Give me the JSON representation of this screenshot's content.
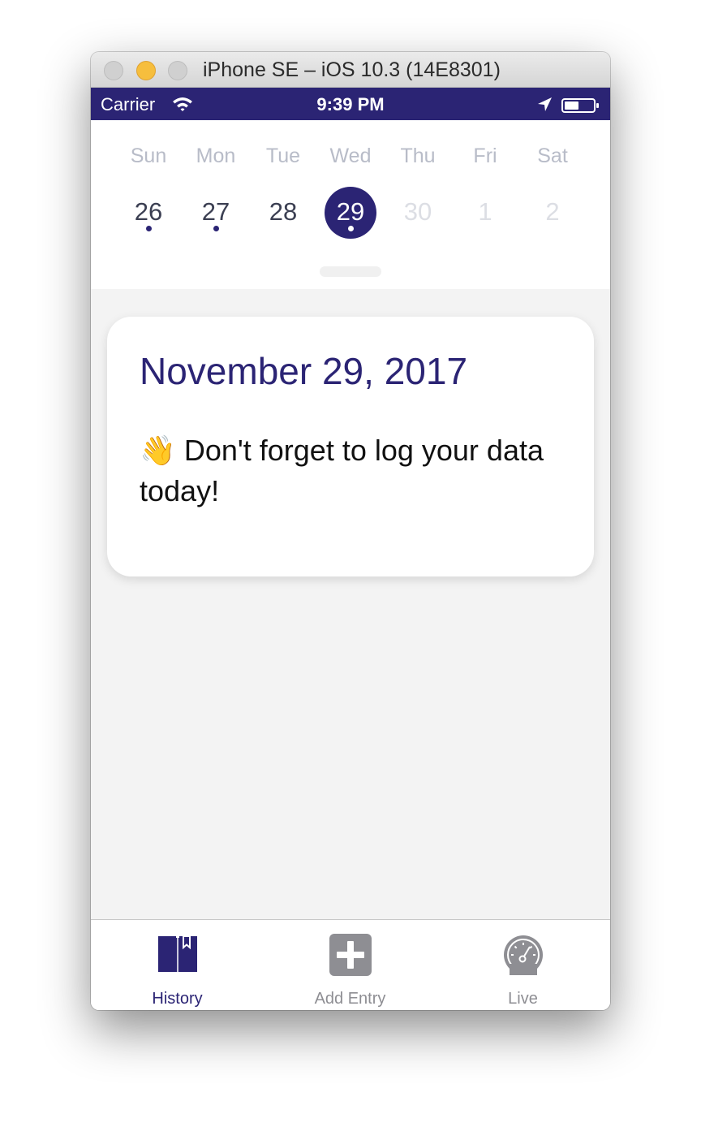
{
  "window": {
    "title": "iPhone SE – iOS 10.3 (14E8301)"
  },
  "status_bar": {
    "carrier": "Carrier",
    "time": "9:39 PM",
    "battery_level": 0.5
  },
  "colors": {
    "brand": "#2b2474",
    "inactive_day_name": "#b8bcc8",
    "future_day": "#dcdee4",
    "tab_inactive": "#8e8e93"
  },
  "week": {
    "days": [
      {
        "name": "Sun",
        "date": "26",
        "has_entry": true,
        "state": "past"
      },
      {
        "name": "Mon",
        "date": "27",
        "has_entry": true,
        "state": "past"
      },
      {
        "name": "Tue",
        "date": "28",
        "has_entry": false,
        "state": "past"
      },
      {
        "name": "Wed",
        "date": "29",
        "has_entry": true,
        "state": "selected"
      },
      {
        "name": "Thu",
        "date": "30",
        "has_entry": false,
        "state": "future"
      },
      {
        "name": "Fri",
        "date": "1",
        "has_entry": false,
        "state": "future"
      },
      {
        "name": "Sat",
        "date": "2",
        "has_entry": false,
        "state": "future"
      }
    ]
  },
  "card": {
    "date": "November 29, 2017",
    "emoji": "👋",
    "message": "Don't forget to log your data today!"
  },
  "tab_bar": {
    "tabs": [
      {
        "label": "History",
        "icon": "book-bookmark-icon",
        "active": true
      },
      {
        "label": "Add Entry",
        "icon": "plus-square-icon",
        "active": false
      },
      {
        "label": "Live",
        "icon": "speedometer-icon",
        "active": false
      }
    ]
  }
}
